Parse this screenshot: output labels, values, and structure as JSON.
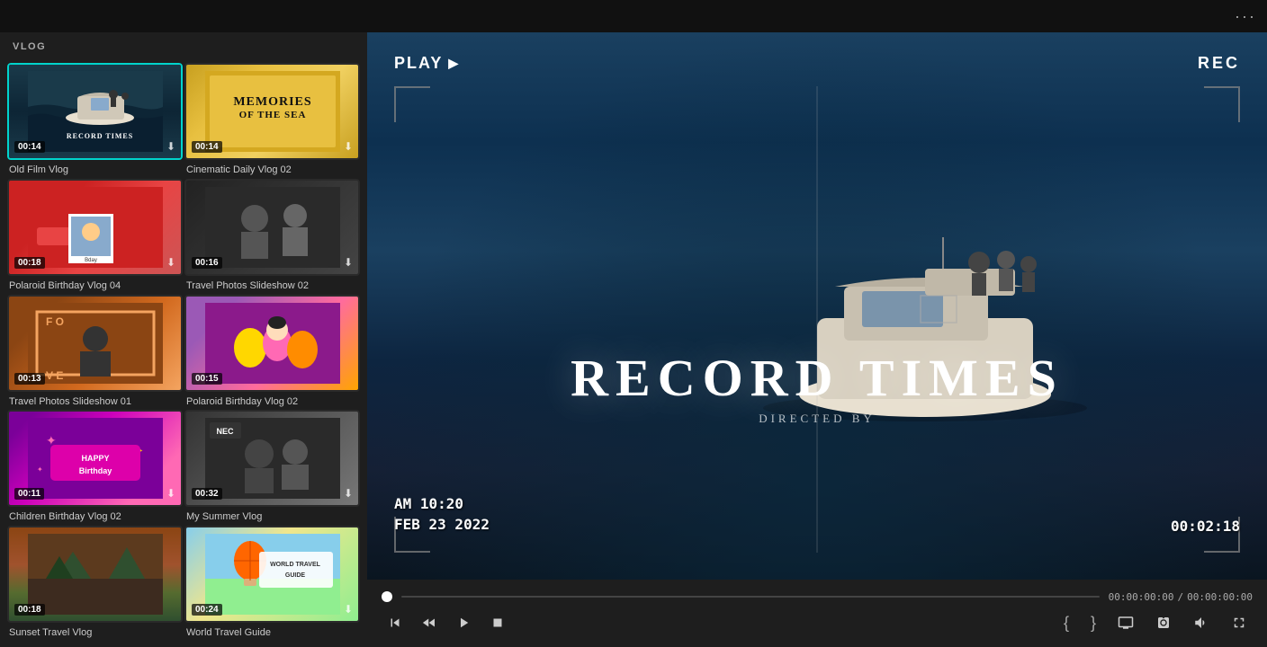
{
  "topbar": {
    "dots": "···"
  },
  "leftPanel": {
    "sectionLabel": "VLOG",
    "thumbnails": [
      {
        "id": "old-film-vlog",
        "label": "Old Film Vlog",
        "time": "00:14",
        "selected": true,
        "style": "old-film",
        "hasDownload": true
      },
      {
        "id": "cinematic-daily-vlog-02",
        "label": "Cinematic Daily Vlog 02",
        "time": "00:14",
        "selected": false,
        "style": "memories",
        "hasDownload": true
      },
      {
        "id": "polaroid-birthday-vlog-04",
        "label": "Polaroid Birthday Vlog 04",
        "time": "00:18",
        "selected": false,
        "style": "polaroid-04",
        "hasDownload": true
      },
      {
        "id": "travel-photos-slideshow-02",
        "label": "Travel Photos Slideshow 02",
        "time": "00:16",
        "selected": false,
        "style": "travel-02",
        "hasDownload": true
      },
      {
        "id": "travel-photos-slideshow-01",
        "label": "Travel Photos Slideshow 01",
        "time": "00:13",
        "selected": false,
        "style": "travel-01",
        "hasDownload": false
      },
      {
        "id": "polaroid-birthday-vlog-02",
        "label": "Polaroid Birthday Vlog 02",
        "time": "00:15",
        "selected": false,
        "style": "polaroid-02",
        "hasDownload": false
      },
      {
        "id": "children-birthday-vlog-02",
        "label": "Children Birthday Vlog 02",
        "time": "00:11",
        "selected": false,
        "style": "children-bday",
        "hasDownload": true
      },
      {
        "id": "my-summer-vlog",
        "label": "My Summer Vlog",
        "time": "00:32",
        "selected": false,
        "style": "summer",
        "hasDownload": true
      },
      {
        "id": "sunset-travel-vlog",
        "label": "Sunset Travel Vlog",
        "time": "00:18",
        "selected": false,
        "style": "sunset",
        "hasDownload": false
      },
      {
        "id": "world-travel-guide",
        "label": "World Travel Guide",
        "time": "00:24",
        "selected": false,
        "style": "world-travel",
        "hasDownload": true
      }
    ]
  },
  "preview": {
    "playLabel": "PLAY",
    "recLabel": "REC",
    "recordTimesTitle": "RECORD TIMES",
    "directedBy": "DIRECTED BY",
    "timestampLine1": "AM 10:20",
    "timestampLine2": "FEB 23 2022",
    "timecode": "00:02:18"
  },
  "controls": {
    "currentTime": "00:00:00:00",
    "totalTime": "00:00:00:00",
    "separator": "/"
  }
}
